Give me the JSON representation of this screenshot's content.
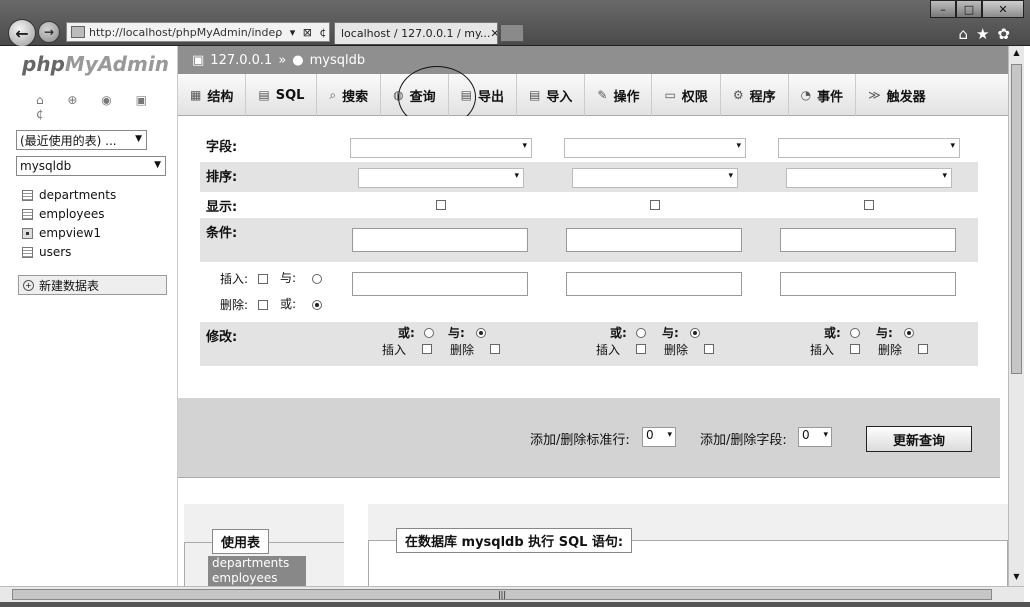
{
  "browser": {
    "url": "http://localhost/phpMyAdmin/inde",
    "url_controls": "ρ ▾ ⊠ ¢ ✕",
    "tab_title": "localhost / 127.0.0.1 / my...",
    "tab_close": "✕",
    "window_controls": {
      "minimize": "–",
      "maximize": "□",
      "close": "✕"
    },
    "toolbar_icons": "⌂★✿"
  },
  "sidebar": {
    "logo_php": "php",
    "logo_myadmin": "MyAdmin",
    "quick_icons": "⌂ ⊕ ◉ ▣ ¢",
    "recent_tables": "(最近使用的表) ...",
    "database": "mysqldb",
    "tables": [
      {
        "name": "departments",
        "kind": "table"
      },
      {
        "name": "employees",
        "kind": "table"
      },
      {
        "name": "empview1",
        "kind": "view"
      },
      {
        "name": "users",
        "kind": "table"
      }
    ],
    "new_table": "新建数据表"
  },
  "breadcrumb": {
    "server": "127.0.0.1",
    "separator": "»",
    "database": "mysqldb"
  },
  "tabs": [
    {
      "label": "结构",
      "icon": "structure-icon"
    },
    {
      "label": "SQL",
      "icon": "sql-icon"
    },
    {
      "label": "搜索",
      "icon": "search-icon"
    },
    {
      "label": "查询",
      "icon": "query-icon"
    },
    {
      "label": "导出",
      "icon": "export-icon"
    },
    {
      "label": "导入",
      "icon": "import-icon"
    },
    {
      "label": "操作",
      "icon": "wrench-icon"
    },
    {
      "label": "权限",
      "icon": "privileges-icon"
    },
    {
      "label": "程序",
      "icon": "routines-icon"
    },
    {
      "label": "事件",
      "icon": "clock-icon"
    },
    {
      "label": "触发器",
      "icon": "trigger-icon"
    }
  ],
  "query_grid": {
    "labels": {
      "field": "字段:",
      "sort": "排序:",
      "show": "显示:",
      "criteria": "条件:",
      "modify": "修改:"
    },
    "insert_label": "插入:",
    "delete_label": "删除:",
    "and_label": "与:",
    "or_label": "或:",
    "col_or": "或:",
    "col_and": "与:",
    "col_insert": "插入",
    "col_delete": "删除"
  },
  "add_remove": {
    "rows_label": "添加/删除标准行:",
    "rows_value": "0",
    "fields_label": "添加/删除字段:",
    "fields_value": "0",
    "update_button": "更新查询"
  },
  "use_tables": {
    "title": "使用表",
    "items": [
      "departments",
      "employees"
    ]
  },
  "sql_box": {
    "title": "在数据库 mysqldb 执行 SQL 语句:"
  }
}
